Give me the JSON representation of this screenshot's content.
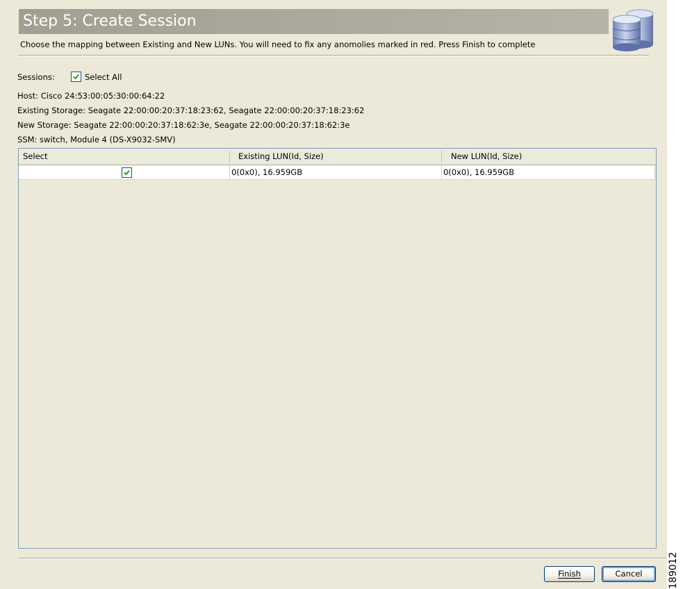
{
  "header": {
    "title": "Step 5: Create Session",
    "subtitle": "Choose the mapping between Existing and New LUNs. You will need to fix any anomolies marked in red. Press Finish to complete",
    "icon": "database-icon"
  },
  "sessions": {
    "label": "Sessions:",
    "select_all_label": "Select All",
    "select_all_checked": true
  },
  "info": {
    "host": "Host: Cisco 24:53:00:05:30:00:64:22",
    "existing_storage": "Existing Storage: Seagate 22:00:00:20:37:18:23:62, Seagate 22:00:00:20:37:18:23:62",
    "new_storage": "New Storage: Seagate 22:00:00:20:37:18:62:3e, Seagate 22:00:00:20:37:18:62:3e",
    "ssm": "SSM: switch, Module 4 (DS-X9032-SMV)"
  },
  "table": {
    "columns": [
      "Select",
      "Existing LUN(Id, Size)",
      "New LUN(Id, Size)"
    ],
    "rows": [
      {
        "selected": true,
        "existing_lun": "0(0x0), 16.959GB",
        "new_lun": "0(0x0), 16.959GB"
      }
    ]
  },
  "buttons": {
    "finish_label": "Finish",
    "cancel_label": "Cancel"
  },
  "figure_id": "189012",
  "colors": {
    "title_bar": "#a29e92",
    "window_bg": "#ece9d8",
    "checkbox_border": "#1c5180",
    "checkmark": "#21a121",
    "button_border": "#003c74"
  }
}
